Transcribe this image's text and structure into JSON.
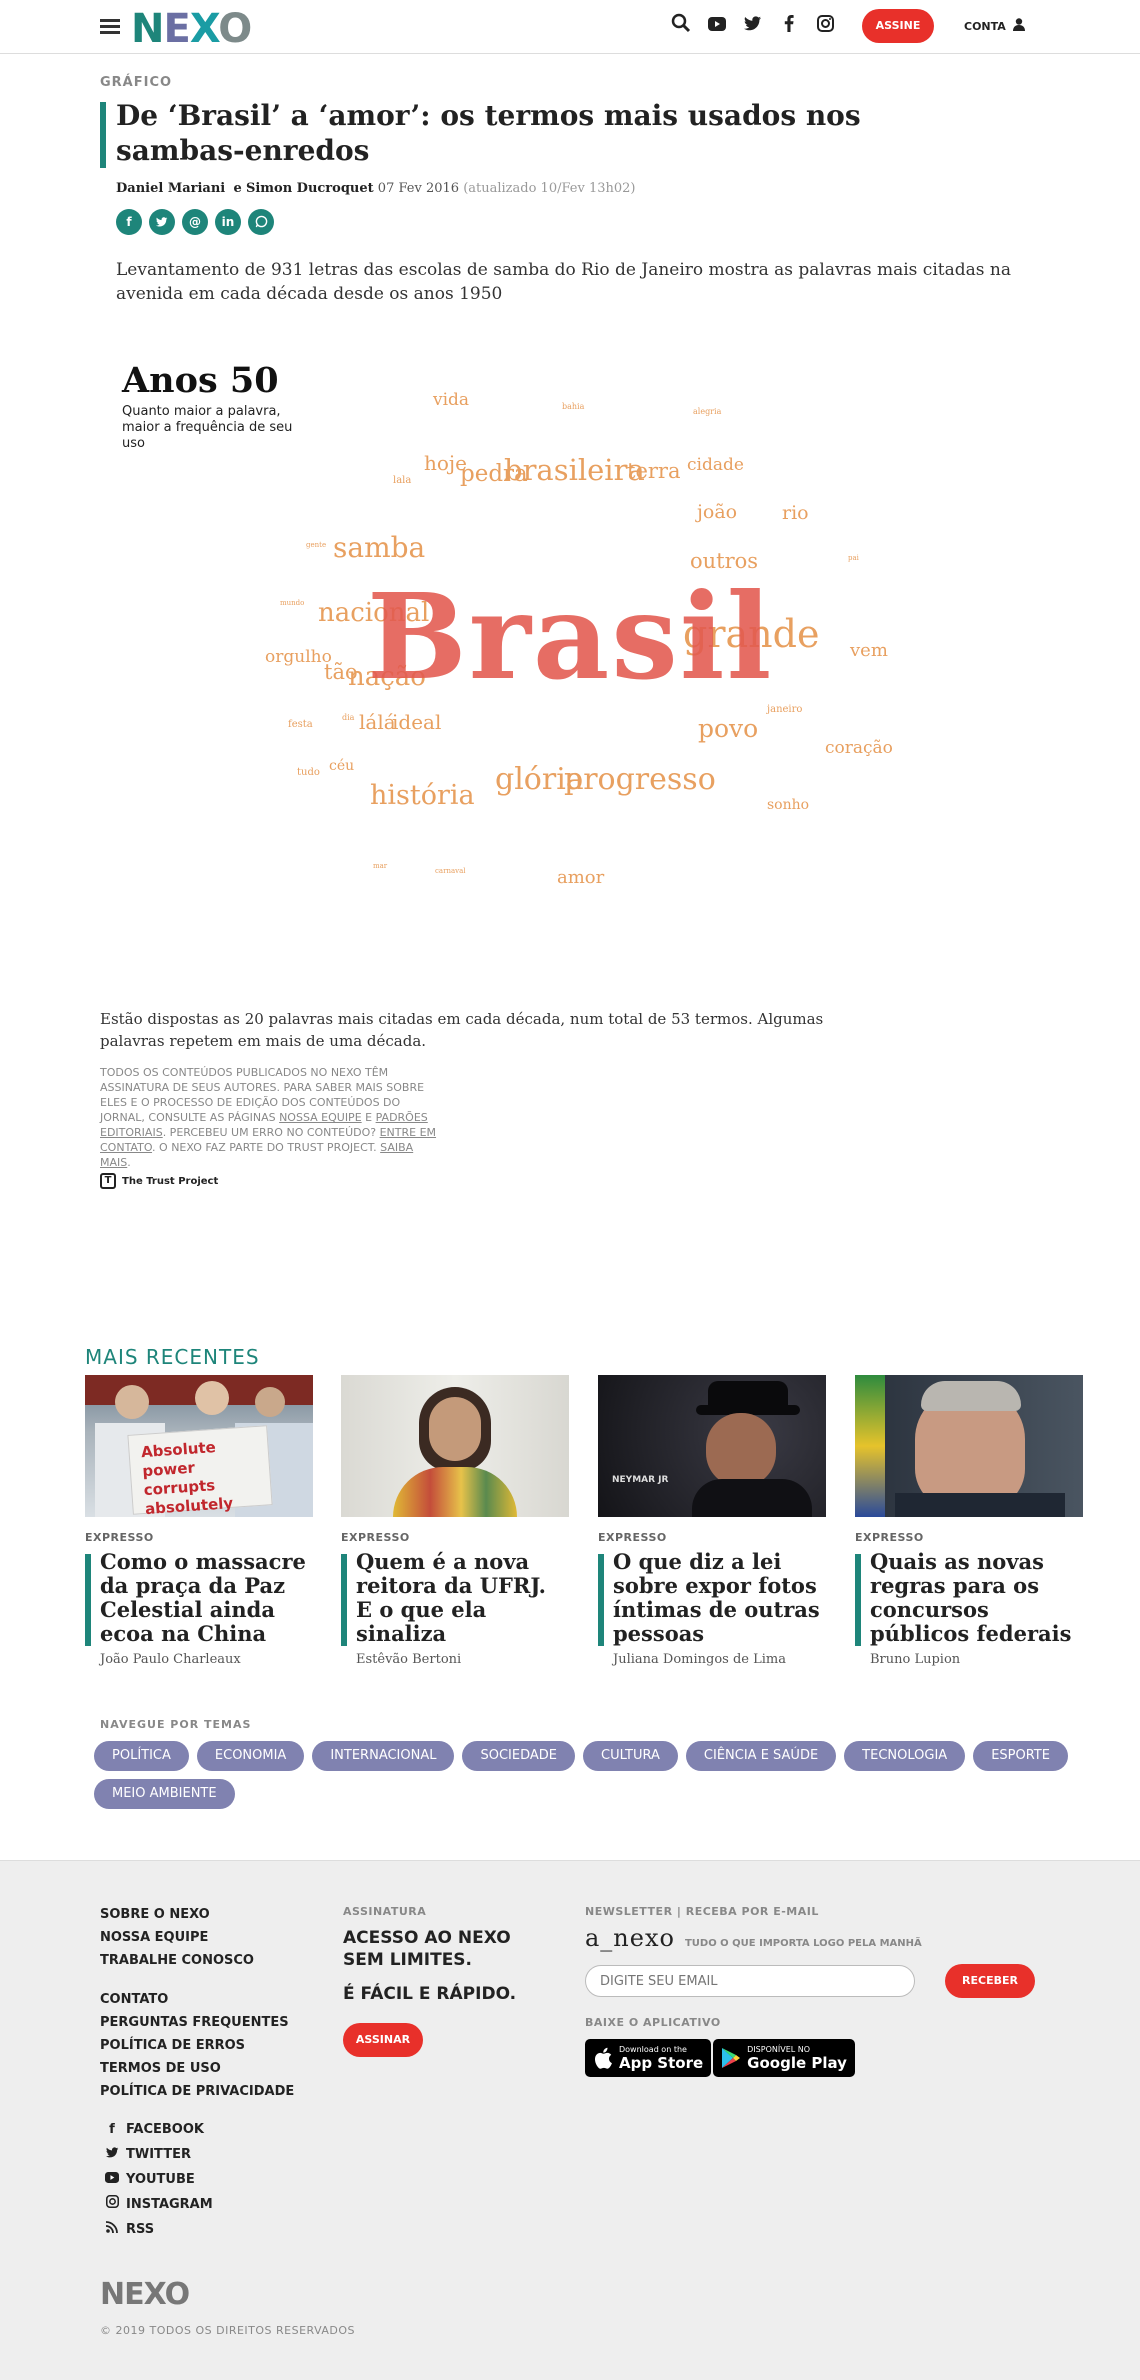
{
  "header": {
    "assine": "ASSINE",
    "conta": "CONTA"
  },
  "article": {
    "kicker": "GRÁFICO",
    "title": "De ‘Brasil’ a ‘amor’: os termos mais usados nos sambas-enredos",
    "author1": "Daniel Mariani",
    "author_sep": "e",
    "author2": "Simon Ducroquet",
    "date": "07 Fev 2016",
    "updated": "(atualizado 10/Fev 13h02)",
    "lede": "Levantamento de 931 letras das escolas de samba do Rio de Janeiro mostra as palavras mais citadas na avenida em cada década desde os anos 1950",
    "caption": "Estão dispostas as 20 palavras mais citadas em cada década, num total de 53 termos. Algumas palavras repetem em mais de uma década.",
    "trust_text1": "Todos os conteúdos publicados no Nexo têm assinatura de seus autores. Para saber mais sobre eles e o processo de edição dos conteúdos do jornal, consulte as páginas",
    "trust_link1": "Nossa equipe",
    "trust_and": "e",
    "trust_link2": "Padrões editoriais",
    "trust_text2": ". Percebeu um erro no conteúdo?",
    "trust_link3": "Entre em contato",
    "trust_text3": ". O Nexo faz parte do Trust Project.",
    "trust_link4": "Saiba mais",
    "trust_end": ".",
    "trust_logo": "The Trust Project"
  },
  "cloud": {
    "title": "Anos 50",
    "subtitle": "Quanto maior a palavra, maior a frequência de seu uso",
    "big": "Brasil",
    "words": [
      "vida",
      "bahia",
      "alegria",
      "hoje",
      "pedra",
      "brasileira",
      "terra",
      "cidade",
      "joão",
      "rio",
      "lala",
      "samba",
      "gente",
      "outros",
      "nacional",
      "mundo",
      "grande",
      "vem",
      "orgulho",
      "tão",
      "nação",
      "festa",
      "dia",
      "lálá",
      "ideal",
      "janeiro",
      "povo",
      "coração",
      "tudo",
      "céu",
      "história",
      "glória",
      "progresso",
      "sonho",
      "mar",
      "carnaval",
      "amor",
      "pai"
    ]
  },
  "recent": {
    "title": "MAIS RECENTES",
    "cards": [
      {
        "kicker": "EXPRESSO",
        "title": "Como o massacre da praça da Paz Celestial ainda ecoa na China",
        "author": "João Paulo Charleaux",
        "sign": "Absolute power corrupts absolutely"
      },
      {
        "kicker": "EXPRESSO",
        "title": "Quem é a nova reitora da UFRJ. E o que ela sinaliza",
        "author": "Estêvão Bertoni"
      },
      {
        "kicker": "EXPRESSO",
        "title": "O que diz a lei sobre expor fotos íntimas de outras pessoas",
        "author": "Juliana Domingos de Lima",
        "sign": "NEYMAR JR"
      },
      {
        "kicker": "EXPRESSO",
        "title": "Quais as novas regras para os concursos públicos federais",
        "author": "Bruno Lupion"
      }
    ]
  },
  "temas": {
    "label": "NAVEGUE POR TEMAS",
    "tags": [
      "POLÍTICA",
      "ECONOMIA",
      "INTERNACIONAL",
      "SOCIEDADE",
      "CULTURA",
      "CIÊNCIA E SAÚDE",
      "TECNOLOGIA",
      "ESPORTE",
      "MEIO AMBIENTE"
    ]
  },
  "footer": {
    "links1": [
      "SOBRE O NEXO",
      "NOSSA EQUIPE",
      "TRABALHE CONOSCO"
    ],
    "links2": [
      "CONTATO",
      "PERGUNTAS FREQUENTES",
      "POLÍTICA DE ERROS",
      "TERMOS DE USO",
      "POLÍTICA DE PRIVACIDADE"
    ],
    "social": [
      "FACEBOOK",
      "TWITTER",
      "YOUTUBE",
      "INSTAGRAM",
      "RSS"
    ],
    "assinatura_label": "ASSINATURA",
    "assinatura_l1": "ACESSO AO NEXO SEM LIMITES.",
    "assinatura_l2": "É FÁCIL E RÁPIDO.",
    "assinar": "ASSINAR",
    "newsletter_label": "NEWSLETTER | RECEBA POR E-MAIL",
    "anexo": "a_nexo",
    "anexo_tag": "TUDO O QUE IMPORTA LOGO PELA MANHÃ",
    "email_placeholder": "DIGITE SEU EMAIL",
    "receber": "RECEBER",
    "app_label": "BAIXE O APLICATIVO",
    "appstore_small": "Download on the",
    "appstore_big": "App Store",
    "gplay_small": "DISPONÍVEL NO",
    "gplay_big": "Google Play",
    "copyright": "© 2019 TODOS OS DIREITOS RESERVADOS"
  }
}
